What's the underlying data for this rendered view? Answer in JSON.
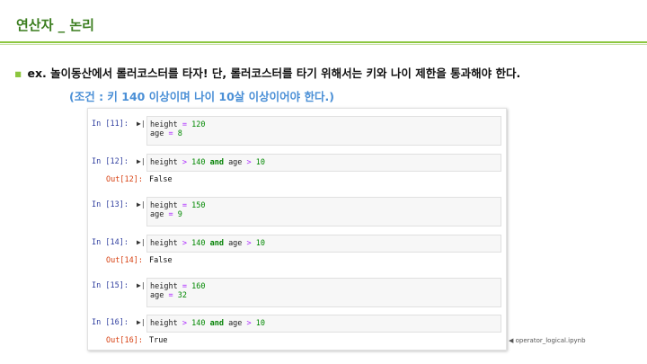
{
  "header": {
    "title": "연산자 _ 논리"
  },
  "content": {
    "bullet": "ex. 놀이동산에서 롤러코스터를 타자! 단, 롤러코스터를 타기 위해서는 키와 나이 제한을 통과해야 한다.",
    "condition": "(조건 : 키 140 이상이며 나이 10살 이상이어야 한다.)"
  },
  "notebook": {
    "cells": [
      {
        "prompt": "In [11]:",
        "var1": "height",
        "eq1": "=",
        "val1": "120",
        "var2": "age",
        "eq2": "=",
        "val2": "8"
      },
      {
        "prompt": "In [12]:",
        "out_prompt": "Out[12]:",
        "output": "False"
      },
      {
        "prompt": "In [13]:",
        "var1": "height",
        "eq1": "=",
        "val1": "150",
        "var2": "age",
        "eq2": "=",
        "val2": "9"
      },
      {
        "prompt": "In [14]:",
        "out_prompt": "Out[14]:",
        "output": "False"
      },
      {
        "prompt": "In [15]:",
        "var1": "height",
        "eq1": "=",
        "val1": "160",
        "var2": "age",
        "eq2": "=",
        "val2": "32"
      },
      {
        "prompt": "In [16]:",
        "out_prompt": "Out[16]:",
        "output": "True"
      }
    ],
    "expr": {
      "v1": "height",
      "op1": ">",
      "n1": "140",
      "and": "and",
      "v2": "age",
      "op2": ">",
      "n2": "10"
    },
    "run_icon": "▶|"
  },
  "footer": {
    "marker": "◀",
    "filename": "operator_logical.ipynb"
  }
}
